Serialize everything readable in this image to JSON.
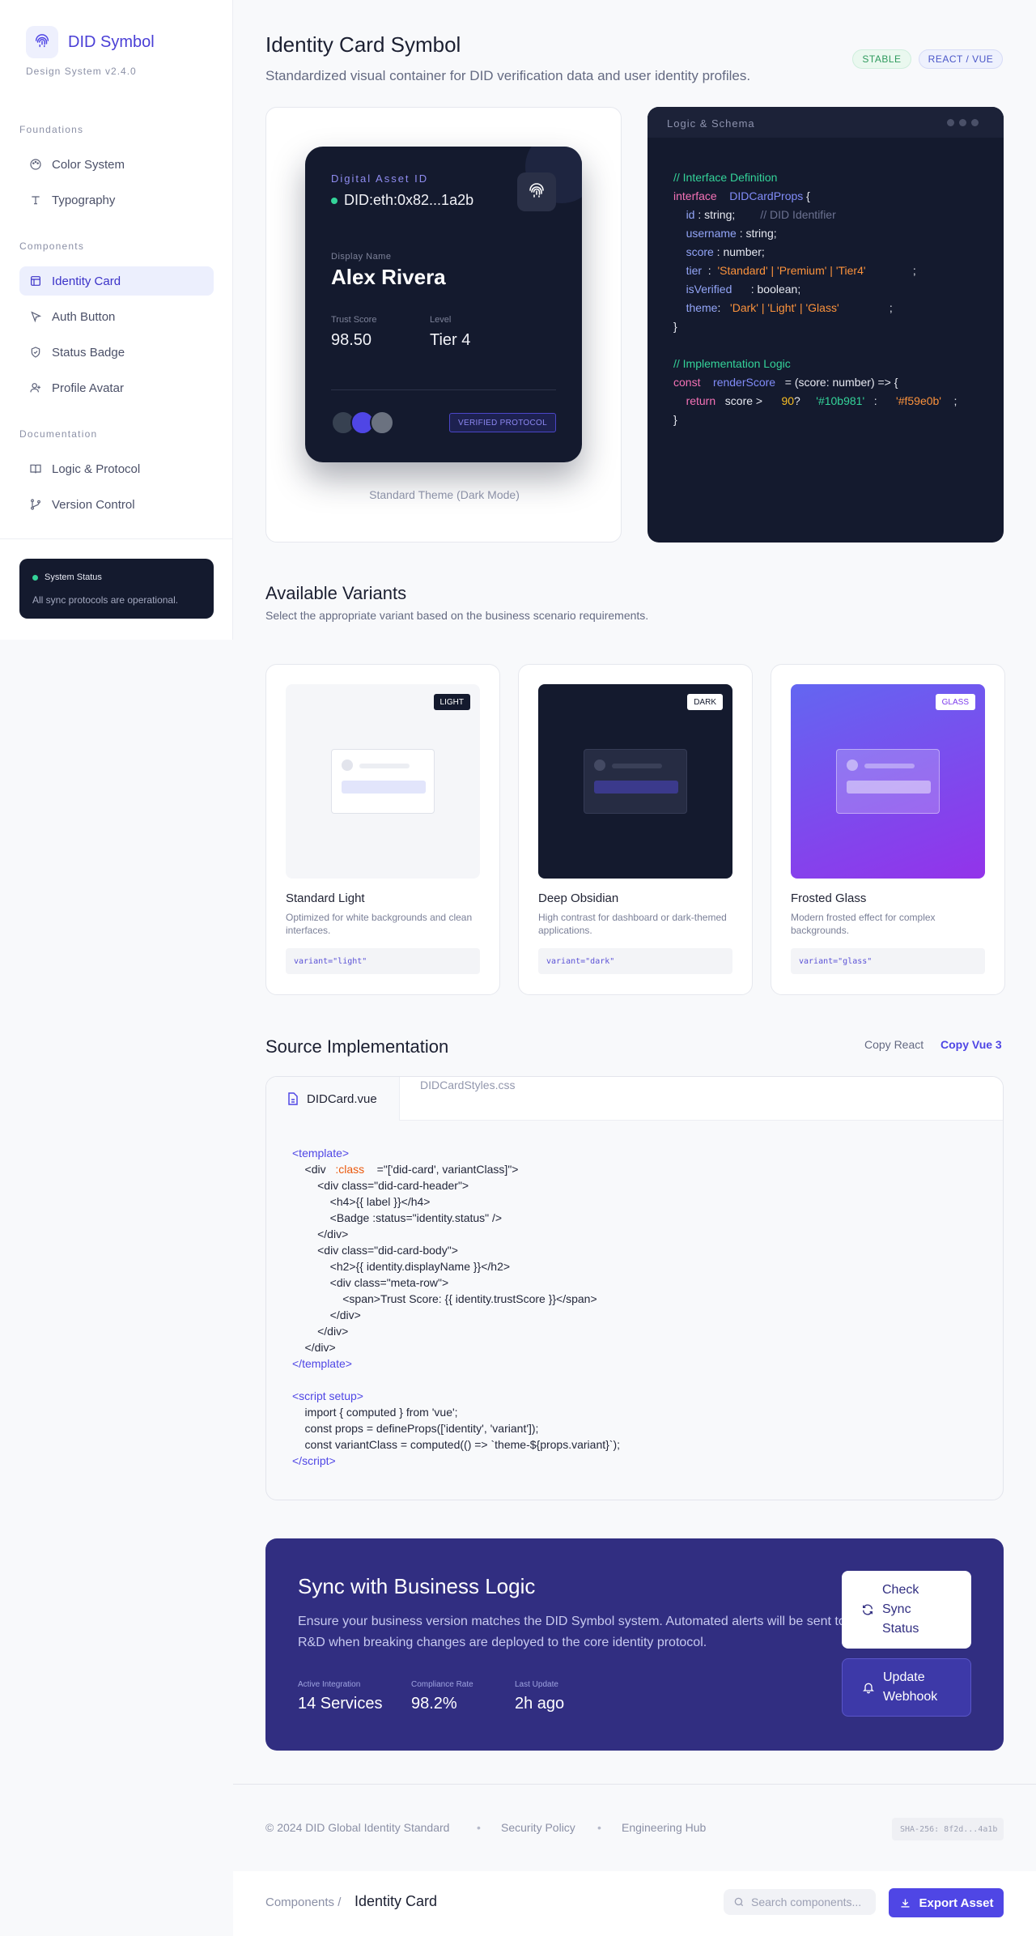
{
  "brand": {
    "name": "DID Symbol",
    "version": "Design System v2.4.0"
  },
  "sidebar": {
    "sections": [
      {
        "title": "Foundations",
        "items": [
          {
            "label": "Color System",
            "icon": "palette-icon"
          },
          {
            "label": "Typography",
            "icon": "type-icon"
          }
        ]
      },
      {
        "title": "Components",
        "items": [
          {
            "label": "Identity Card",
            "icon": "layout-icon",
            "active": true
          },
          {
            "label": "Auth Button",
            "icon": "cursor-icon"
          },
          {
            "label": "Status Badge",
            "icon": "shield-icon"
          },
          {
            "label": "Profile Avatar",
            "icon": "user-icon"
          }
        ]
      },
      {
        "title": "Documentation",
        "items": [
          {
            "label": "Logic & Protocol",
            "icon": "book-icon"
          },
          {
            "label": "Version Control",
            "icon": "git-branch-icon"
          }
        ]
      }
    ],
    "status": {
      "title": "System Status",
      "text": "All sync protocols are operational."
    }
  },
  "header": {
    "title": "Identity Card Symbol",
    "subtitle": "Standardized visual container for DID verification data and user identity profiles.",
    "badges": [
      "STABLE",
      "REACT / VUE"
    ]
  },
  "card": {
    "asset_label": "Digital Asset ID",
    "asset_value": "DID:eth:0x82...1a2b",
    "display_name_label": "Display Name",
    "display_name": "Alex Rivera",
    "trust_label": "Trust Score",
    "trust_value": "98.50",
    "level_label": "Level",
    "level_value": "Tier 4",
    "verified": "VERIFIED PROTOCOL",
    "caption": "Standard Theme (Dark Mode)",
    "avatar_colors": [
      "#374151",
      "#4f46e5",
      "#6b7280"
    ]
  },
  "schema": {
    "title": "Logic & Schema",
    "interface_comment": "// Interface Definition",
    "logic_comment": "// Implementation Logic"
  },
  "variants": {
    "title": "Available Variants",
    "subtitle": "Select the appropriate variant based on the business scenario requirements.",
    "items": [
      {
        "tag": "LIGHT",
        "name": "Standard Light",
        "desc": "Optimized for white backgrounds and clean interfaces.",
        "code": "variant=\"light\""
      },
      {
        "tag": "DARK",
        "name": "Deep Obsidian",
        "desc": "High contrast for dashboard or dark-themed applications.",
        "code": "variant=\"dark\""
      },
      {
        "tag": "GLASS",
        "name": "Frosted Glass",
        "desc": "Modern frosted effect for complex backgrounds.",
        "code": "variant=\"glass\""
      }
    ]
  },
  "source": {
    "title": "Source Implementation",
    "copy_react": "Copy React",
    "copy_vue": "Copy Vue 3",
    "tab_active": "DIDCard.vue",
    "tab_other": "DIDCardStyles.css"
  },
  "sync": {
    "title": "Sync with Business Logic",
    "text_line1": "Ensure your business version matches the DID Symbol system. Automated alerts will be sent to",
    "text_line2": "R&D when breaking changes are deployed to the core identity protocol.",
    "stats": [
      {
        "label": "Active Integration",
        "value": "14 Services"
      },
      {
        "label": "Compliance Rate",
        "value": "98.2%"
      },
      {
        "label": "Last Update",
        "value": "2h ago"
      }
    ],
    "check_button": "Check Sync Status",
    "webhook_button": "Update Webhook"
  },
  "footer": {
    "copyright": "© 2024 DID Global Identity Standard",
    "security": "Security Policy",
    "hub": "Engineering Hub",
    "hash": "SHA-256: 8f2d...4a1b",
    "separator": "•"
  },
  "bottombar": {
    "crumb_parent": "Components /",
    "crumb_current": "Identity Card",
    "search_placeholder": "Search components...",
    "export": "Export Asset"
  },
  "colors": {
    "accent": "#4f46e5",
    "dark": "#141a2e",
    "sync_bg": "#312e81",
    "success": "#34d399"
  }
}
